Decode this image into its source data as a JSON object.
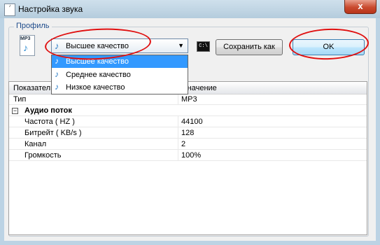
{
  "window": {
    "title": "Настройка звука",
    "close_label": "x"
  },
  "profile": {
    "group_label": "Профиль",
    "file_badge": "MP3",
    "selected": "Высшее качество",
    "options": [
      "Высшее качество",
      "Среднее качество",
      "Низкое качество"
    ],
    "cmd_icon_text": "C:\\",
    "save_as_label": "Сохранить как",
    "ok_label": "OK"
  },
  "grid": {
    "col_name": "Показатель",
    "col_value": "Значение",
    "rows": [
      {
        "name": "Тип",
        "value": "MP3"
      },
      {
        "name": "Аудио поток",
        "value": ""
      },
      {
        "name": "Частота ( HZ )",
        "value": "44100"
      },
      {
        "name": "Битрейт ( KB/s )",
        "value": "128"
      },
      {
        "name": "Канал",
        "value": "2"
      },
      {
        "name": "Громкость",
        "value": "100%"
      }
    ]
  },
  "colors": {
    "selection": "#3399ff",
    "annotation": "#e01010"
  }
}
